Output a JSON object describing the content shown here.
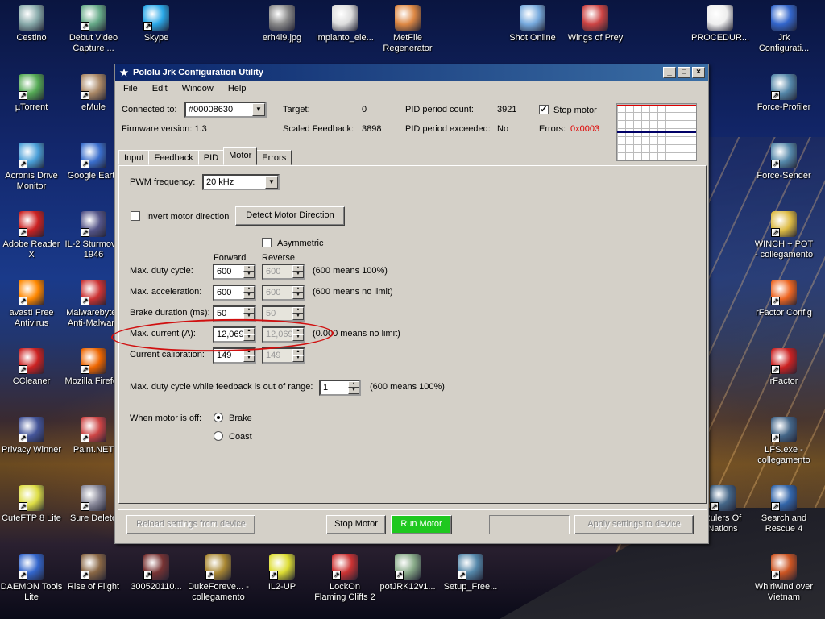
{
  "desktop": {
    "icons_left": [
      {
        "label": "Cestino",
        "color": "#8aa"
      },
      {
        "label": "Debut Video Capture ...",
        "color": "#6a8"
      },
      {
        "label": "Skype",
        "color": "#2aa8e8"
      },
      {
        "label": "µTorrent",
        "color": "#5a5"
      },
      {
        "label": "eMule",
        "color": "#a86"
      },
      {
        "label": "Acronis Drive Monitor",
        "color": "#4a9fd8"
      },
      {
        "label": "Google Earth",
        "color": "#3a6ecc"
      },
      {
        "label": "Adobe Reader X",
        "color": "#c22"
      },
      {
        "label": "IL-2 Sturmovik 1946",
        "color": "#558"
      },
      {
        "label": "avast! Free Antivirus",
        "color": "#f80"
      },
      {
        "label": "Malwarebytes Anti-Malware",
        "color": "#c33"
      },
      {
        "label": "CCleaner",
        "color": "#c22"
      },
      {
        "label": "Mozilla Firefox",
        "color": "#e60"
      },
      {
        "label": "Privacy Winner",
        "color": "#459"
      },
      {
        "label": "Paint.NET",
        "color": "#c44"
      },
      {
        "label": "CuteFTP 8 Lite",
        "color": "#dd4"
      },
      {
        "label": "Sure Delete",
        "color": "#889"
      },
      {
        "label": "DAEMON Tools Lite",
        "color": "#36c"
      },
      {
        "label": "Rise of Flight",
        "color": "#864"
      },
      {
        "label": "300520110...",
        "color": "#733"
      },
      {
        "label": "DukeForeve... - collegamento",
        "color": "#a83"
      },
      {
        "label": "IL2-UP",
        "color": "#dd3"
      },
      {
        "label": "LockOn Flaming Cliffs 2",
        "color": "#c33"
      },
      {
        "label": "potJRK12v1...",
        "color": "#8a8"
      },
      {
        "label": "Setup_Free...",
        "color": "#58a"
      }
    ],
    "icons_top": [
      {
        "label": "erh4i9.jpg",
        "color": "#888"
      },
      {
        "label": "impianto_ele...",
        "color": "#ddd"
      },
      {
        "label": "MetFile Regenerator",
        "color": "#d84"
      },
      {
        "label": "Shot Online",
        "color": "#7ad"
      },
      {
        "label": "Wings of Prey",
        "color": "#c44"
      },
      {
        "label": "PROCEDUR...",
        "color": "#eee"
      }
    ],
    "icons_right": [
      {
        "label": "Jrk Configurati...",
        "color": "#36c"
      },
      {
        "label": "Force-Profiler",
        "color": "#58a"
      },
      {
        "label": "Force-Sender",
        "color": "#58a"
      },
      {
        "label": "WINCH + POT - collegamento",
        "color": "#db4"
      },
      {
        "label": "rFactor Config",
        "color": "#e62"
      },
      {
        "label": "rFactor",
        "color": "#c22"
      },
      {
        "label": "LFS.exe - collegamento",
        "color": "#468"
      },
      {
        "label": "Rulers Of Nations",
        "color": "#468"
      },
      {
        "label": "Search and Rescue 4",
        "color": "#36a"
      },
      {
        "label": "Whirlwind over Vietnam",
        "color": "#c52"
      }
    ]
  },
  "window": {
    "title": "Pololu Jrk Configuration Utility",
    "title_icon": "pololu-icon",
    "menu": [
      "File",
      "Edit",
      "Window",
      "Help"
    ],
    "status": {
      "connected_label": "Connected to:",
      "connected_value": "#00008630",
      "firmware_label": "Firmware version: 1.3",
      "target_label": "Target:",
      "target_value": "0",
      "scaled_feedback_label": "Scaled Feedback:",
      "scaled_feedback_value": "3898",
      "pid_count_label": "PID period count:",
      "pid_count_value": "3921",
      "pid_exceeded_label": "PID period exceeded:",
      "pid_exceeded_value": "No",
      "stop_motor_label": "Stop motor",
      "stop_motor_checked": "✓",
      "errors_label": "Errors:",
      "errors_value": "0x0003",
      "error_color": "#e00000"
    },
    "tabs": [
      "Input",
      "Feedback",
      "PID",
      "Motor",
      "Errors"
    ],
    "active_tab": "Motor",
    "motor": {
      "pwm_label": "PWM frequency:",
      "pwm_value": "20 kHz",
      "invert_label": "Invert motor direction",
      "detect_button": "Detect Motor Direction",
      "asymmetric_label": "Asymmetric",
      "forward_header": "Forward",
      "reverse_header": "Reverse",
      "rows": [
        {
          "label": "Max. duty cycle:",
          "forward": "600",
          "reverse": "600",
          "note": "(600 means 100%)"
        },
        {
          "label": "Max. acceleration:",
          "forward": "600",
          "reverse": "600",
          "note": "(600 means no limit)"
        },
        {
          "label": "Brake duration (ms):",
          "forward": "50",
          "reverse": "50",
          "note": ""
        },
        {
          "label": "Max. current (A):",
          "forward": "12,069",
          "reverse": "12,069",
          "note": "(0.000 means no limit)"
        },
        {
          "label": "Current calibration:",
          "forward": "149",
          "reverse": "149",
          "note": ""
        }
      ],
      "feedback_range_label": "Max. duty cycle while feedback is out of range:",
      "feedback_range_value": "1",
      "feedback_range_note": "(600 means 100%)",
      "motor_off_label": "When motor is off:",
      "brake_label": "Brake",
      "coast_label": "Coast"
    },
    "footer": {
      "reload": "Reload settings from device",
      "stop": "Stop Motor",
      "run": "Run Motor",
      "apply": "Apply settings to device"
    }
  }
}
